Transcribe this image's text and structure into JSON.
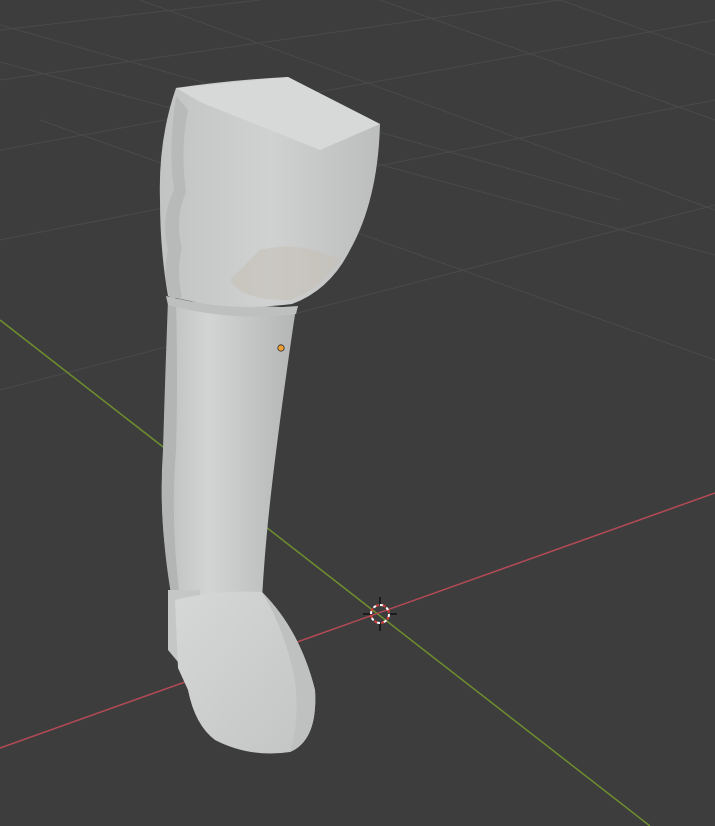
{
  "viewport": {
    "background": "#3d3d3d",
    "grid_color": "#4a4a4a",
    "x_axis_color": "#b34a55",
    "y_axis_color": "#6e8f2e"
  },
  "scene": {
    "object": "boot-mesh",
    "material_color": "#c9caca",
    "origin_color": "#f0a030"
  },
  "icons": {
    "cursor": "3d-cursor-icon",
    "origin": "object-origin-icon"
  }
}
